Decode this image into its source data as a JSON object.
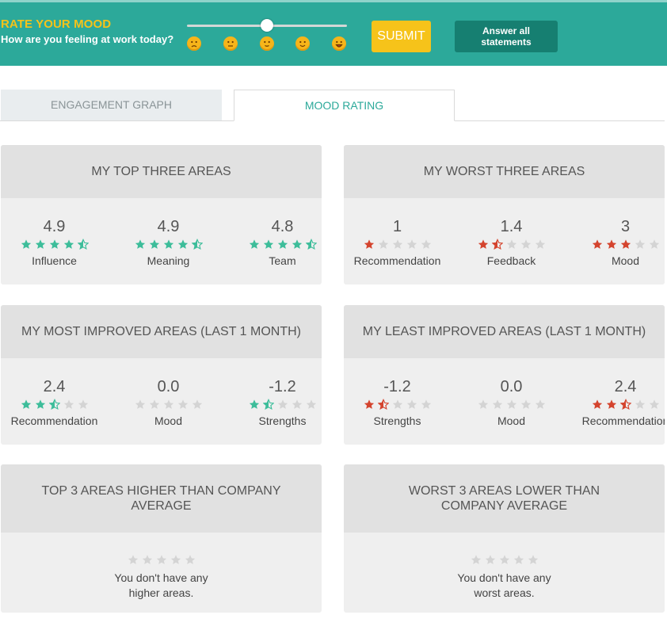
{
  "header": {
    "title": "RATE YOUR MOOD",
    "subtitle": "How are you feeling at work today?",
    "slider_level": 0.5,
    "faces": [
      "frown-face-icon",
      "neutral-face-icon",
      "slight-smile-face-icon",
      "smile-face-icon",
      "grin-face-icon"
    ],
    "submit_label": "SUBMIT",
    "answer_label": "Answer all statements"
  },
  "tabs": [
    {
      "label": "ENGAGEMENT GRAPH",
      "active": false
    },
    {
      "label": "MOOD RATING",
      "active": true
    }
  ],
  "colors": {
    "brand": "#2ca99a",
    "accent": "#f6c31a",
    "good_star": "#3dbd9a",
    "bad_star": "#d4442e",
    "empty_star": "#d4d4d4"
  },
  "cards": [
    {
      "title": "MY TOP THREE AREAS",
      "metrics": [
        {
          "value": "4.9",
          "stars": 4.5,
          "tone": "good",
          "label": "Influence"
        },
        {
          "value": "4.9",
          "stars": 4.5,
          "tone": "good",
          "label": "Meaning"
        },
        {
          "value": "4.8",
          "stars": 4.5,
          "tone": "good",
          "label": "Team"
        }
      ]
    },
    {
      "title": "MY WORST THREE AREAS",
      "metrics": [
        {
          "value": "1",
          "stars": 1,
          "tone": "bad",
          "label": "Recommendation"
        },
        {
          "value": "1.4",
          "stars": 1.5,
          "tone": "bad",
          "label": "Feedback"
        },
        {
          "value": "3",
          "stars": 3,
          "tone": "bad",
          "label": "Mood"
        }
      ]
    },
    {
      "title": "MY MOST IMPROVED AREAS (LAST 1 MONTH)",
      "metrics": [
        {
          "value": "2.4",
          "stars": 2.5,
          "tone": "good",
          "label": "Recommendation"
        },
        {
          "value": "0.0",
          "stars": 0,
          "tone": "good",
          "label": "Mood"
        },
        {
          "value": "-1.2",
          "stars": 1.5,
          "tone": "good",
          "label": "Strengths"
        }
      ]
    },
    {
      "title": "MY LEAST IMPROVED AREAS (LAST 1 MONTH)",
      "metrics": [
        {
          "value": "-1.2",
          "stars": 1.5,
          "tone": "bad",
          "label": "Strengths"
        },
        {
          "value": "0.0",
          "stars": 0,
          "tone": "bad",
          "label": "Mood"
        },
        {
          "value": "2.4",
          "stars": 2.5,
          "tone": "bad",
          "label": "Recommendation"
        }
      ]
    },
    {
      "title": "TOP 3 AREAS HIGHER THAN COMPANY AVERAGE",
      "empty": {
        "line1": "You don't have any",
        "line2": "higher areas."
      }
    },
    {
      "title": "WORST 3 AREAS LOWER THAN COMPANY AVERAGE",
      "empty": {
        "line1": "You don't have any",
        "line2": "worst areas."
      }
    }
  ]
}
